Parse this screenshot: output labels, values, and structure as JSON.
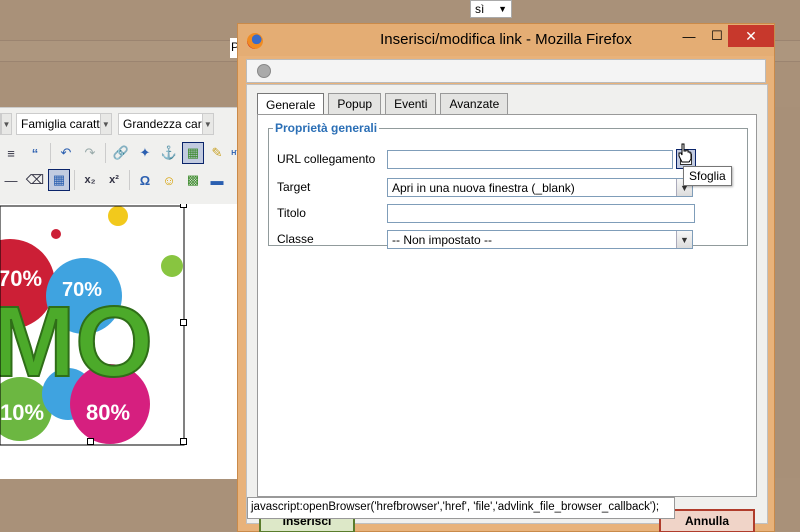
{
  "background": {
    "language_select": "sì",
    "p_fragment": "P",
    "editor": {
      "font_family_label": "Famiglia caratt",
      "font_size_label": "Grandezza car",
      "image_texts": [
        "70%",
        "70%",
        "MO",
        "10%",
        "80%"
      ]
    }
  },
  "window": {
    "title": "Inserisci/modifica link - Mozilla Firefox",
    "minimize": "—",
    "maximize": "☐",
    "close": "✕"
  },
  "tabs": [
    {
      "label": "Generale",
      "selected": true
    },
    {
      "label": "Popup",
      "selected": false
    },
    {
      "label": "Eventi",
      "selected": false
    },
    {
      "label": "Avanzate",
      "selected": false
    }
  ],
  "general": {
    "legend": "Proprietà generali",
    "url_label": "URL collegamento",
    "url_value": "",
    "target_label": "Target",
    "target_value": "Apri in una nuova finestra (_blank)",
    "title_label": "Titolo",
    "title_value": "",
    "class_label": "Classe",
    "class_value": "-- Non impostato --",
    "browse_tooltip": "Sfoglia"
  },
  "buttons": {
    "insert": "Inserisci",
    "cancel": "Annulla"
  },
  "status_text": "javascript:openBrowser('hrefbrowser','href', 'file','advlink_file_browser_callback');"
}
